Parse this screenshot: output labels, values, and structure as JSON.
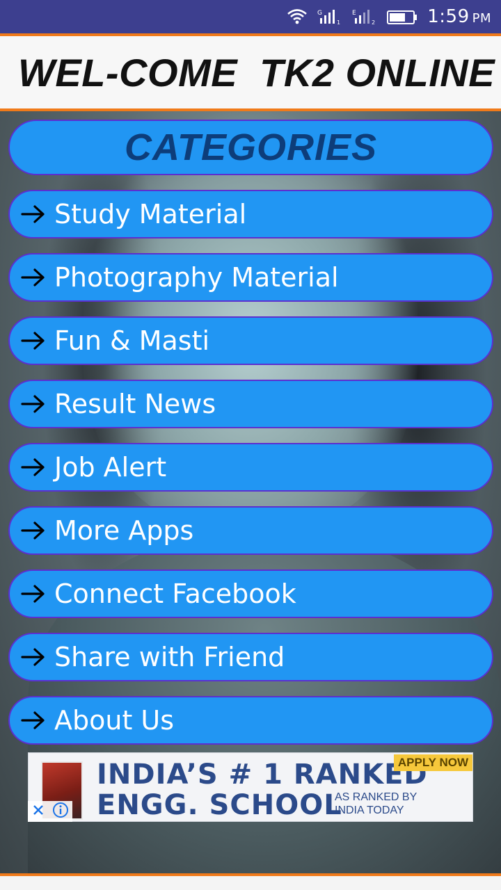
{
  "status_bar": {
    "time": "1:59",
    "ampm": "PM",
    "signal1_label": "G",
    "signal1_sub": "1",
    "signal2_label": "E",
    "signal2_sub": "2"
  },
  "header": {
    "title": "WEL-COME  TK2 ONLINE"
  },
  "categories_title": "CATEGORIES",
  "menu": [
    {
      "label": "Study Material",
      "icon": "arrow-right-icon"
    },
    {
      "label": "Photography Material",
      "icon": "arrow-right-icon"
    },
    {
      "label": "Fun & Masti",
      "icon": "arrow-right-icon"
    },
    {
      "label": "Result News",
      "icon": "arrow-right-icon"
    },
    {
      "label": "Job Alert",
      "icon": "arrow-right-icon"
    },
    {
      "label": "More Apps",
      "icon": "arrow-right-icon"
    },
    {
      "label": "Connect Facebook",
      "icon": "arrow-right-icon"
    },
    {
      "label": "Share with Friend",
      "icon": "arrow-right-icon"
    },
    {
      "label": "About Us",
      "icon": "arrow-right-icon"
    }
  ],
  "ad": {
    "line1": "INDIA’S # 1 RANKED",
    "line2": "ENGG. SCHOOL",
    "cta": "APPLY NOW",
    "sub": "AS RANKED BY INDIA TODAY"
  },
  "colors": {
    "status_bar": "#3d3f8f",
    "accent_orange": "#f07a1a",
    "pill_blue": "#2196f3",
    "pill_border": "#5c2fcf",
    "categories_text": "#0d3d7a"
  }
}
